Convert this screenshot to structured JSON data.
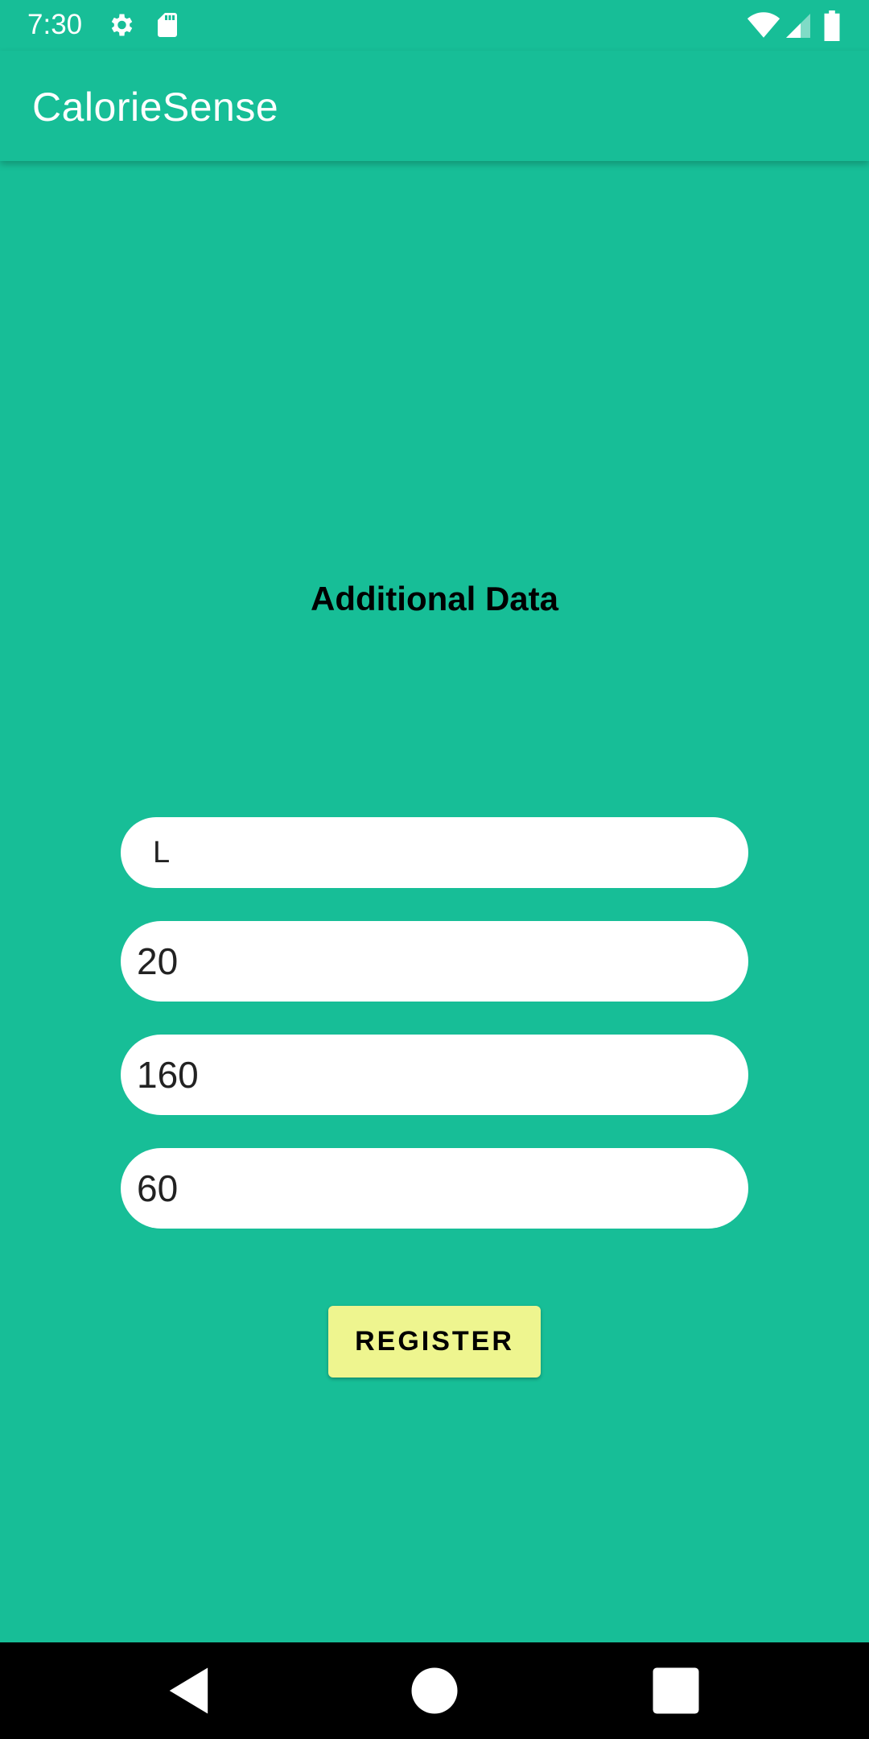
{
  "status_bar": {
    "time": "7:30",
    "icons": [
      "gear-icon",
      "sd-card-icon",
      "wifi-icon",
      "signal-icon",
      "battery-icon"
    ]
  },
  "app_bar": {
    "title": "CalorieSense"
  },
  "form": {
    "heading": "Additional Data",
    "fields": [
      {
        "value": "L"
      },
      {
        "value": "20"
      },
      {
        "value": "160"
      },
      {
        "value": "60"
      }
    ],
    "register_label": "REGISTER"
  },
  "nav_bar": {
    "icons": [
      "back-icon",
      "home-icon",
      "recents-icon"
    ]
  },
  "colors": {
    "background": "#17BE97",
    "button": "#EEF58F",
    "field": "#FFFFFF",
    "nav": "#000000"
  }
}
